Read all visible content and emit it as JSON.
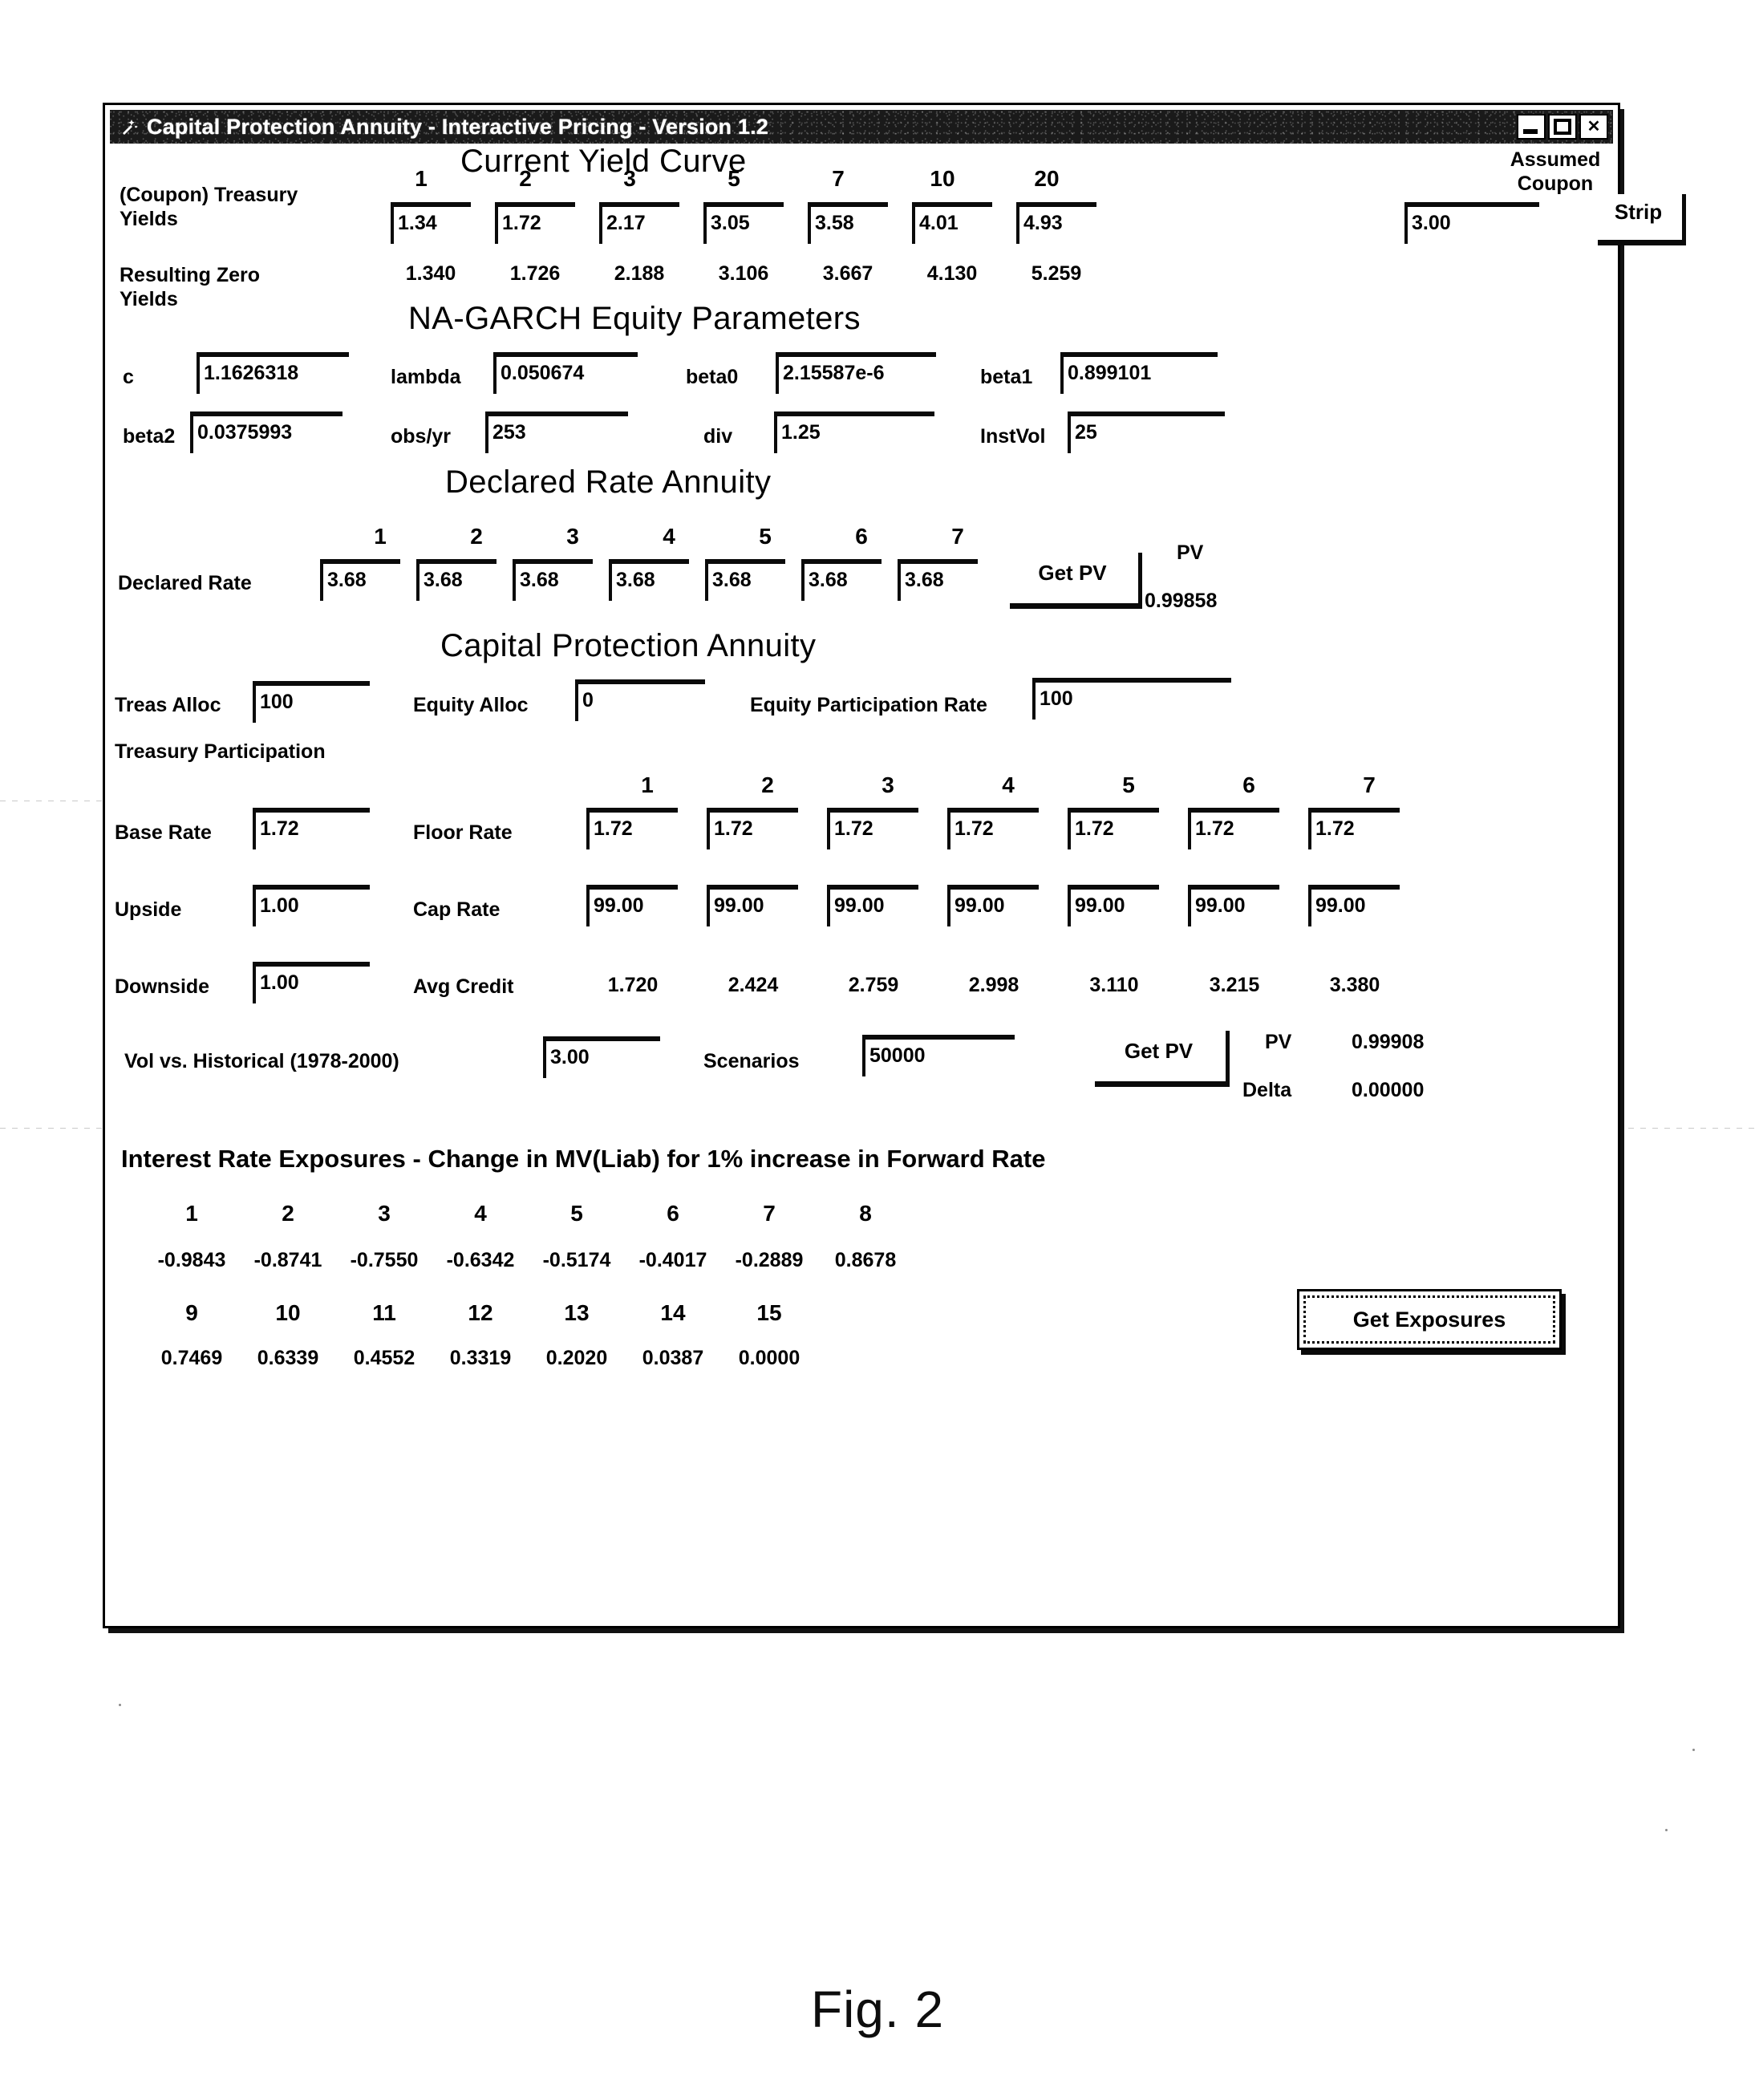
{
  "window": {
    "title": "Capital Protection Annuity - Interactive Pricing - Version 1.2",
    "icon": "wand-icon",
    "minimize_label": "_",
    "maximize_label": "□",
    "close_label": "✕"
  },
  "figure": {
    "caption": "Fig. 2"
  },
  "yield_curve": {
    "title": "Current Yield Curve",
    "assumed_coupon_label_line1": "Assumed",
    "assumed_coupon_label_line2": "Coupon",
    "treasury_label_line1": "(Coupon) Treasury",
    "treasury_label_line2": "Yields",
    "zero_label_line1": "Resulting Zero",
    "zero_label_line2": "Yields",
    "maturities": [
      "1",
      "2",
      "3",
      "5",
      "7",
      "10",
      "20"
    ],
    "treasury_yields": [
      "1.34",
      "1.72",
      "2.17",
      "3.05",
      "3.58",
      "4.01",
      "4.93"
    ],
    "assumed_coupon": "3.00",
    "strip_button": "Strip",
    "zero_yields": [
      "1.340",
      "1.726",
      "2.188",
      "3.106",
      "3.667",
      "4.130",
      "5.259"
    ]
  },
  "garch": {
    "title": "NA-GARCH Equity Parameters",
    "fields": [
      {
        "label": "c",
        "value": "1.1626318"
      },
      {
        "label": "lambda",
        "value": "0.050674"
      },
      {
        "label": "beta0",
        "value": "2.15587e-6"
      },
      {
        "label": "beta1",
        "value": "0.899101"
      },
      {
        "label": "beta2",
        "value": "0.0375993"
      },
      {
        "label": "obs/yr",
        "value": "253"
      },
      {
        "label": "div",
        "value": "1.25"
      },
      {
        "label": "InstVol",
        "value": "25"
      }
    ]
  },
  "declared_rate_annuity": {
    "title": "Declared Rate Annuity",
    "row_label": "Declared Rate",
    "columns": [
      "1",
      "2",
      "3",
      "4",
      "5",
      "6",
      "7"
    ],
    "values": [
      "3.68",
      "3.68",
      "3.68",
      "3.68",
      "3.68",
      "3.68",
      "3.68"
    ],
    "get_pv_button": "Get PV",
    "pv_label": "PV",
    "pv_value": "0.99858"
  },
  "capital_protection_annuity": {
    "title": "Capital Protection Annuity",
    "treas_alloc_label": "Treas Alloc",
    "treas_alloc_value": "100",
    "equity_alloc_label": "Equity Alloc",
    "equity_alloc_value": "0",
    "equity_participation_label": "Equity Participation Rate",
    "equity_participation_value": "100",
    "treasury_participation_label": "Treasury Participation",
    "columns": [
      "1",
      "2",
      "3",
      "4",
      "5",
      "6",
      "7"
    ],
    "base_rate_label": "Base Rate",
    "base_rate_value": "1.72",
    "floor_rate_label": "Floor Rate",
    "floor_rates": [
      "1.72",
      "1.72",
      "1.72",
      "1.72",
      "1.72",
      "1.72",
      "1.72"
    ],
    "upside_label": "Upside",
    "upside_value": "1.00",
    "cap_rate_label": "Cap Rate",
    "cap_rates": [
      "99.00",
      "99.00",
      "99.00",
      "99.00",
      "99.00",
      "99.00",
      "99.00"
    ],
    "downside_label": "Downside",
    "downside_value": "1.00",
    "avg_credit_label": "Avg Credit",
    "avg_credits": [
      "1.720",
      "2.424",
      "2.759",
      "2.998",
      "3.110",
      "3.215",
      "3.380"
    ],
    "vol_label": "Vol vs. Historical (1978-2000)",
    "vol_value": "3.00",
    "scenarios_label": "Scenarios",
    "scenarios_value": "50000",
    "get_pv_button": "Get PV",
    "pv_label": "PV",
    "pv_value": "0.99908",
    "delta_label": "Delta",
    "delta_value": "0.00000"
  },
  "exposures": {
    "title": "Interest Rate Exposures - Change in MV(Liab) for 1% increase in Forward Rate",
    "row1_columns": [
      "1",
      "2",
      "3",
      "4",
      "5",
      "6",
      "7",
      "8"
    ],
    "row1_values": [
      "-0.9843",
      "-0.8741",
      "-0.7550",
      "-0.6342",
      "-0.5174",
      "-0.4017",
      "-0.2889",
      "0.8678"
    ],
    "row2_columns": [
      "9",
      "10",
      "11",
      "12",
      "13",
      "14",
      "15"
    ],
    "row2_values": [
      "0.7469",
      "0.6339",
      "0.4552",
      "0.3319",
      "0.2020",
      "0.0387",
      "0.0000"
    ],
    "get_exposures_button": "Get Exposures"
  }
}
